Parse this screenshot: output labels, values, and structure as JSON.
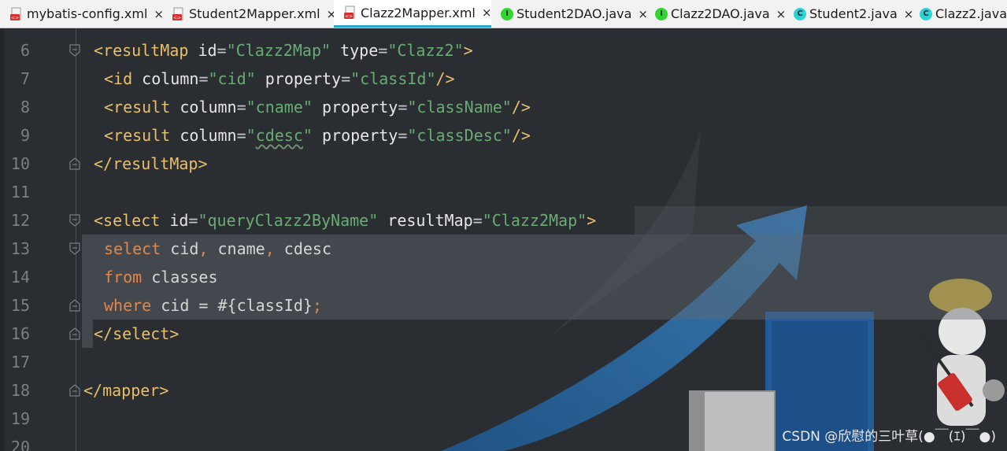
{
  "tabs": [
    {
      "label": "mybatis-config.xml",
      "icon": "xml-file-icon",
      "active": false
    },
    {
      "label": "Student2Mapper.xml",
      "icon": "xml-file-icon",
      "active": false
    },
    {
      "label": "Clazz2Mapper.xml",
      "icon": "xml-file-icon",
      "active": true
    },
    {
      "label": "Student2DAO.java",
      "icon": "interface-icon",
      "glyph": "I",
      "active": false
    },
    {
      "label": "Clazz2DAO.java",
      "icon": "interface-icon",
      "glyph": "I",
      "active": false
    },
    {
      "label": "Student2.java",
      "icon": "class-icon",
      "glyph": "C",
      "active": false
    },
    {
      "label": "Clazz2.java",
      "icon": "class-icon",
      "glyph": "C",
      "active": false
    }
  ],
  "close_glyph": "×",
  "line_numbers": [
    "6",
    "7",
    "8",
    "9",
    "10",
    "11",
    "12",
    "13",
    "14",
    "15",
    "16",
    "17",
    "18",
    "19",
    "20"
  ],
  "code": {
    "l6": {
      "open": "<",
      "tag": "resultMap",
      "a1": " id",
      "eq1": "=",
      "v1": "\"Clazz2Map\"",
      "a2": " type",
      "eq2": "=",
      "v2": "\"Clazz2\"",
      "close": ">"
    },
    "l7": {
      "open": "<",
      "tag": "id",
      "a1": " column",
      "eq1": "=",
      "v1": "\"cid\"",
      "a2": " property",
      "eq2": "=",
      "v2": "\"classId\"",
      "close": "/>"
    },
    "l8": {
      "open": "<",
      "tag": "result",
      "a1": " column",
      "eq1": "=",
      "v1": "\"cname\"",
      "a2": " property",
      "eq2": "=",
      "v2": "\"className\"",
      "close": "/>"
    },
    "l9": {
      "open": "<",
      "tag": "result",
      "a1": " column",
      "eq1": "=",
      "v1a": "\"",
      "v1b": "cdesc",
      "v1c": "\"",
      "a2": " property",
      "eq2": "=",
      "v2": "\"classDesc\"",
      "close": "/>"
    },
    "l10": {
      "open": "</",
      "tag": "resultMap",
      "close": ">"
    },
    "l12": {
      "open": "<",
      "tag": "select",
      "a1": " id",
      "eq1": "=",
      "v1": "\"queryClazz2ByName\"",
      "a2": " resultMap",
      "eq2": "=",
      "v2": "\"Clazz2Map\"",
      "close": ">"
    },
    "l13": {
      "kw": "select",
      "t1": " cid",
      "p1": ",",
      "t2": " cname",
      "p2": ",",
      "t3": " cdesc"
    },
    "l14": {
      "kw": "from",
      "t1": " classes"
    },
    "l15": {
      "kw": "where",
      "t1": " cid = #{classId}",
      "p1": ";"
    },
    "l16": {
      "open": "</",
      "tag": "select",
      "close": ">"
    },
    "l18": {
      "open": "</",
      "tag": "mapper",
      "close": ">"
    }
  },
  "watermark": "CSDN @欣慰的三叶草(●￣(ｴ)￣●)",
  "colors": {
    "tag": "#e8bf6a",
    "string": "#6aab73",
    "keyword": "#e0884c",
    "active_tab_underline": "#2aa6c9"
  }
}
